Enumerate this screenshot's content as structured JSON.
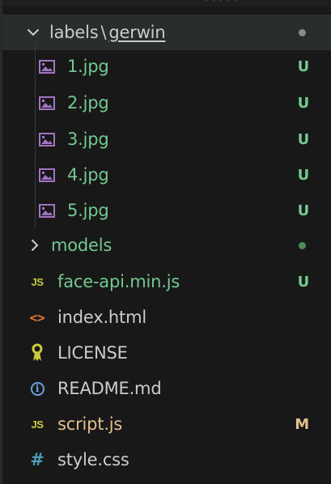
{
  "colors": {
    "untracked_green": "#73c991",
    "modified_yellow": "#e2c08d",
    "default_text": "#cccccc",
    "image_purple": "#a074c4",
    "js_yellow": "#cbcb41",
    "html_orange": "#e37933",
    "info_blue": "#6ca0dc",
    "hash_blue": "#519aba",
    "license_yellow": "#cbcb41"
  },
  "explorer": {
    "open_folder": {
      "parent": "labels",
      "separator": "\\",
      "name": "gerwin",
      "icon": "chevron-down-icon",
      "status_dot_color": "#8a8a8a"
    },
    "images": [
      {
        "name": "1.jpg",
        "status": "U",
        "icon": "image-icon"
      },
      {
        "name": "2.jpg",
        "status": "U",
        "icon": "image-icon"
      },
      {
        "name": "3.jpg",
        "status": "U",
        "icon": "image-icon"
      },
      {
        "name": "4.jpg",
        "status": "U",
        "icon": "image-icon"
      },
      {
        "name": "5.jpg",
        "status": "U",
        "icon": "image-icon"
      }
    ],
    "models_folder": {
      "name": "models",
      "icon": "chevron-right-icon",
      "status_dot_color": "#4e8a5a"
    },
    "files": [
      {
        "name": "face-api.min.js",
        "status": "U",
        "icon_text": "JS",
        "icon": "js-file-icon"
      },
      {
        "name": "index.html",
        "status": "",
        "icon_text": "<>",
        "icon": "html-file-icon"
      },
      {
        "name": "LICENSE",
        "status": "",
        "icon_text": "",
        "icon": "license-file-icon"
      },
      {
        "name": "README.md",
        "status": "",
        "icon_text": "i",
        "icon": "info-icon"
      },
      {
        "name": "script.js",
        "status": "M",
        "icon_text": "JS",
        "icon": "js-file-icon"
      },
      {
        "name": "style.css",
        "status": "",
        "icon_text": "#",
        "icon": "hash-icon"
      }
    ]
  }
}
